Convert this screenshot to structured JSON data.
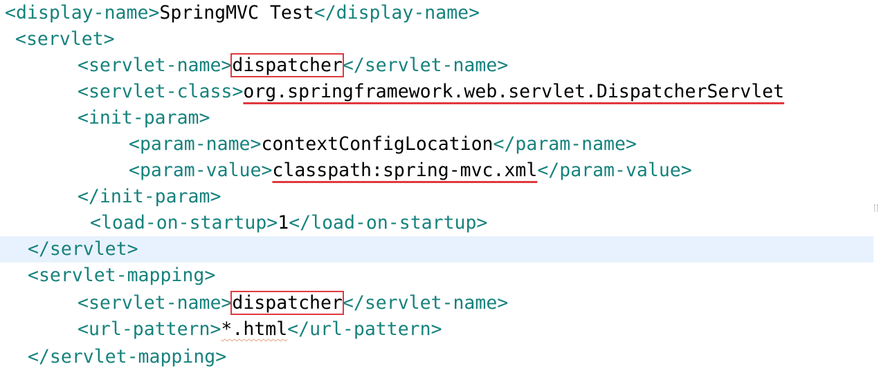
{
  "editor": {
    "colors": {
      "tag": "#17827d",
      "text": "#000000",
      "annotation": "#e0393e",
      "current_line": "#e8f2fe"
    },
    "lines": [
      {
        "pre": "<display-name>",
        "text": "SpringMVC Test",
        "post": "</display-name>"
      },
      {
        "pre": "<servlet>"
      },
      {
        "pre": "<servlet-name>",
        "text": "dispatcher",
        "post": "</servlet-name>"
      },
      {
        "pre": "<servlet-class>",
        "text": "org.springframework.web.servlet.DispatcherServlet"
      },
      {
        "pre": "<init-param>"
      },
      {
        "pre": "<param-name>",
        "text": "contextConfigLocation",
        "post": "</param-name>"
      },
      {
        "pre": "<param-value>",
        "text": "classpath:spring-mvc.xml",
        "post": "</param-value>"
      },
      {
        "pre": "</init-param>"
      },
      {
        "pre": "<load-on-startup>",
        "text": "1",
        "post": "</load-on-startup>"
      },
      {
        "pre": "</servlet>"
      },
      {
        "pre": "<servlet-mapping>"
      },
      {
        "pre": "<servlet-name>",
        "text": "dispatcher",
        "post": "</servlet-name>"
      },
      {
        "pre": "<url-pattern>",
        "text": "*.html",
        "post": "</url-pattern>"
      },
      {
        "pre": "</servlet-mapping>"
      }
    ]
  }
}
